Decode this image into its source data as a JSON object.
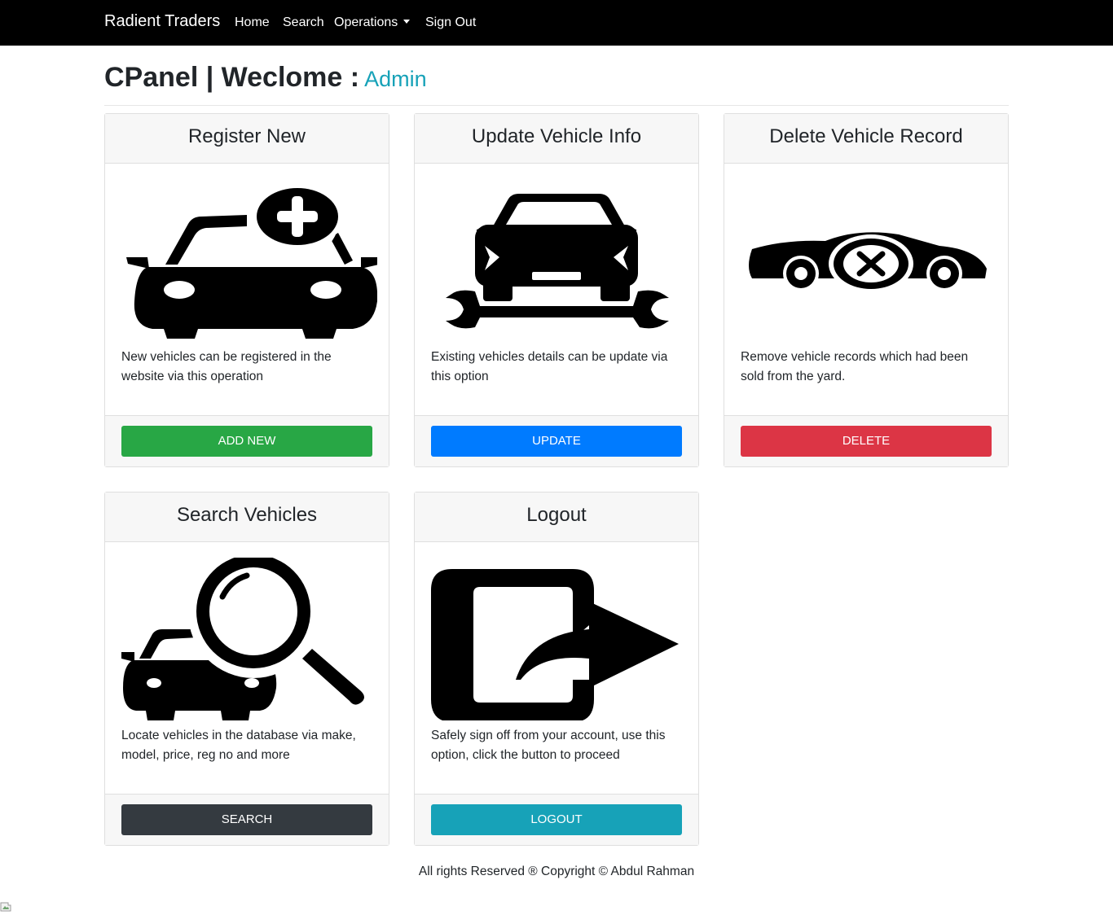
{
  "navbar": {
    "brand": "Radient Traders",
    "links": {
      "home": "Home",
      "search": "Search",
      "operations": "Operations",
      "signout": "Sign Out"
    }
  },
  "header": {
    "title": "CPanel | Weclome :",
    "user": "Admin"
  },
  "cards": {
    "register": {
      "title": "Register New",
      "text": "New vehicles can be registered in the website via this operation",
      "button": "ADD NEW",
      "button_color": "#28a745",
      "icon": "car-add-icon"
    },
    "update": {
      "title": "Update Vehicle Info",
      "text": "Existing vehicles details can be update via this option",
      "button": "UPDATE",
      "button_color": "#007bff",
      "icon": "car-wrench-icon"
    },
    "delete": {
      "title": "Delete Vehicle Record",
      "text": "Remove vehicle records which had been sold from the yard.",
      "button": "DELETE",
      "button_color": "#dc3545",
      "icon": "car-delete-icon"
    },
    "search": {
      "title": "Search Vehicles",
      "text": "Locate vehicles in the database via make, model, price, reg no and more",
      "button": "SEARCH",
      "button_color": "#343a40",
      "icon": "car-search-icon"
    },
    "logout": {
      "title": "Logout",
      "text": "Safely sign off from your account, use this option, click the button to proceed",
      "button": "LOGOUT",
      "button_color": "#17a2b8",
      "icon": "logout-icon"
    }
  },
  "footer": {
    "text": "All rights Reserved ® Copyright © Abdul Rahman"
  }
}
